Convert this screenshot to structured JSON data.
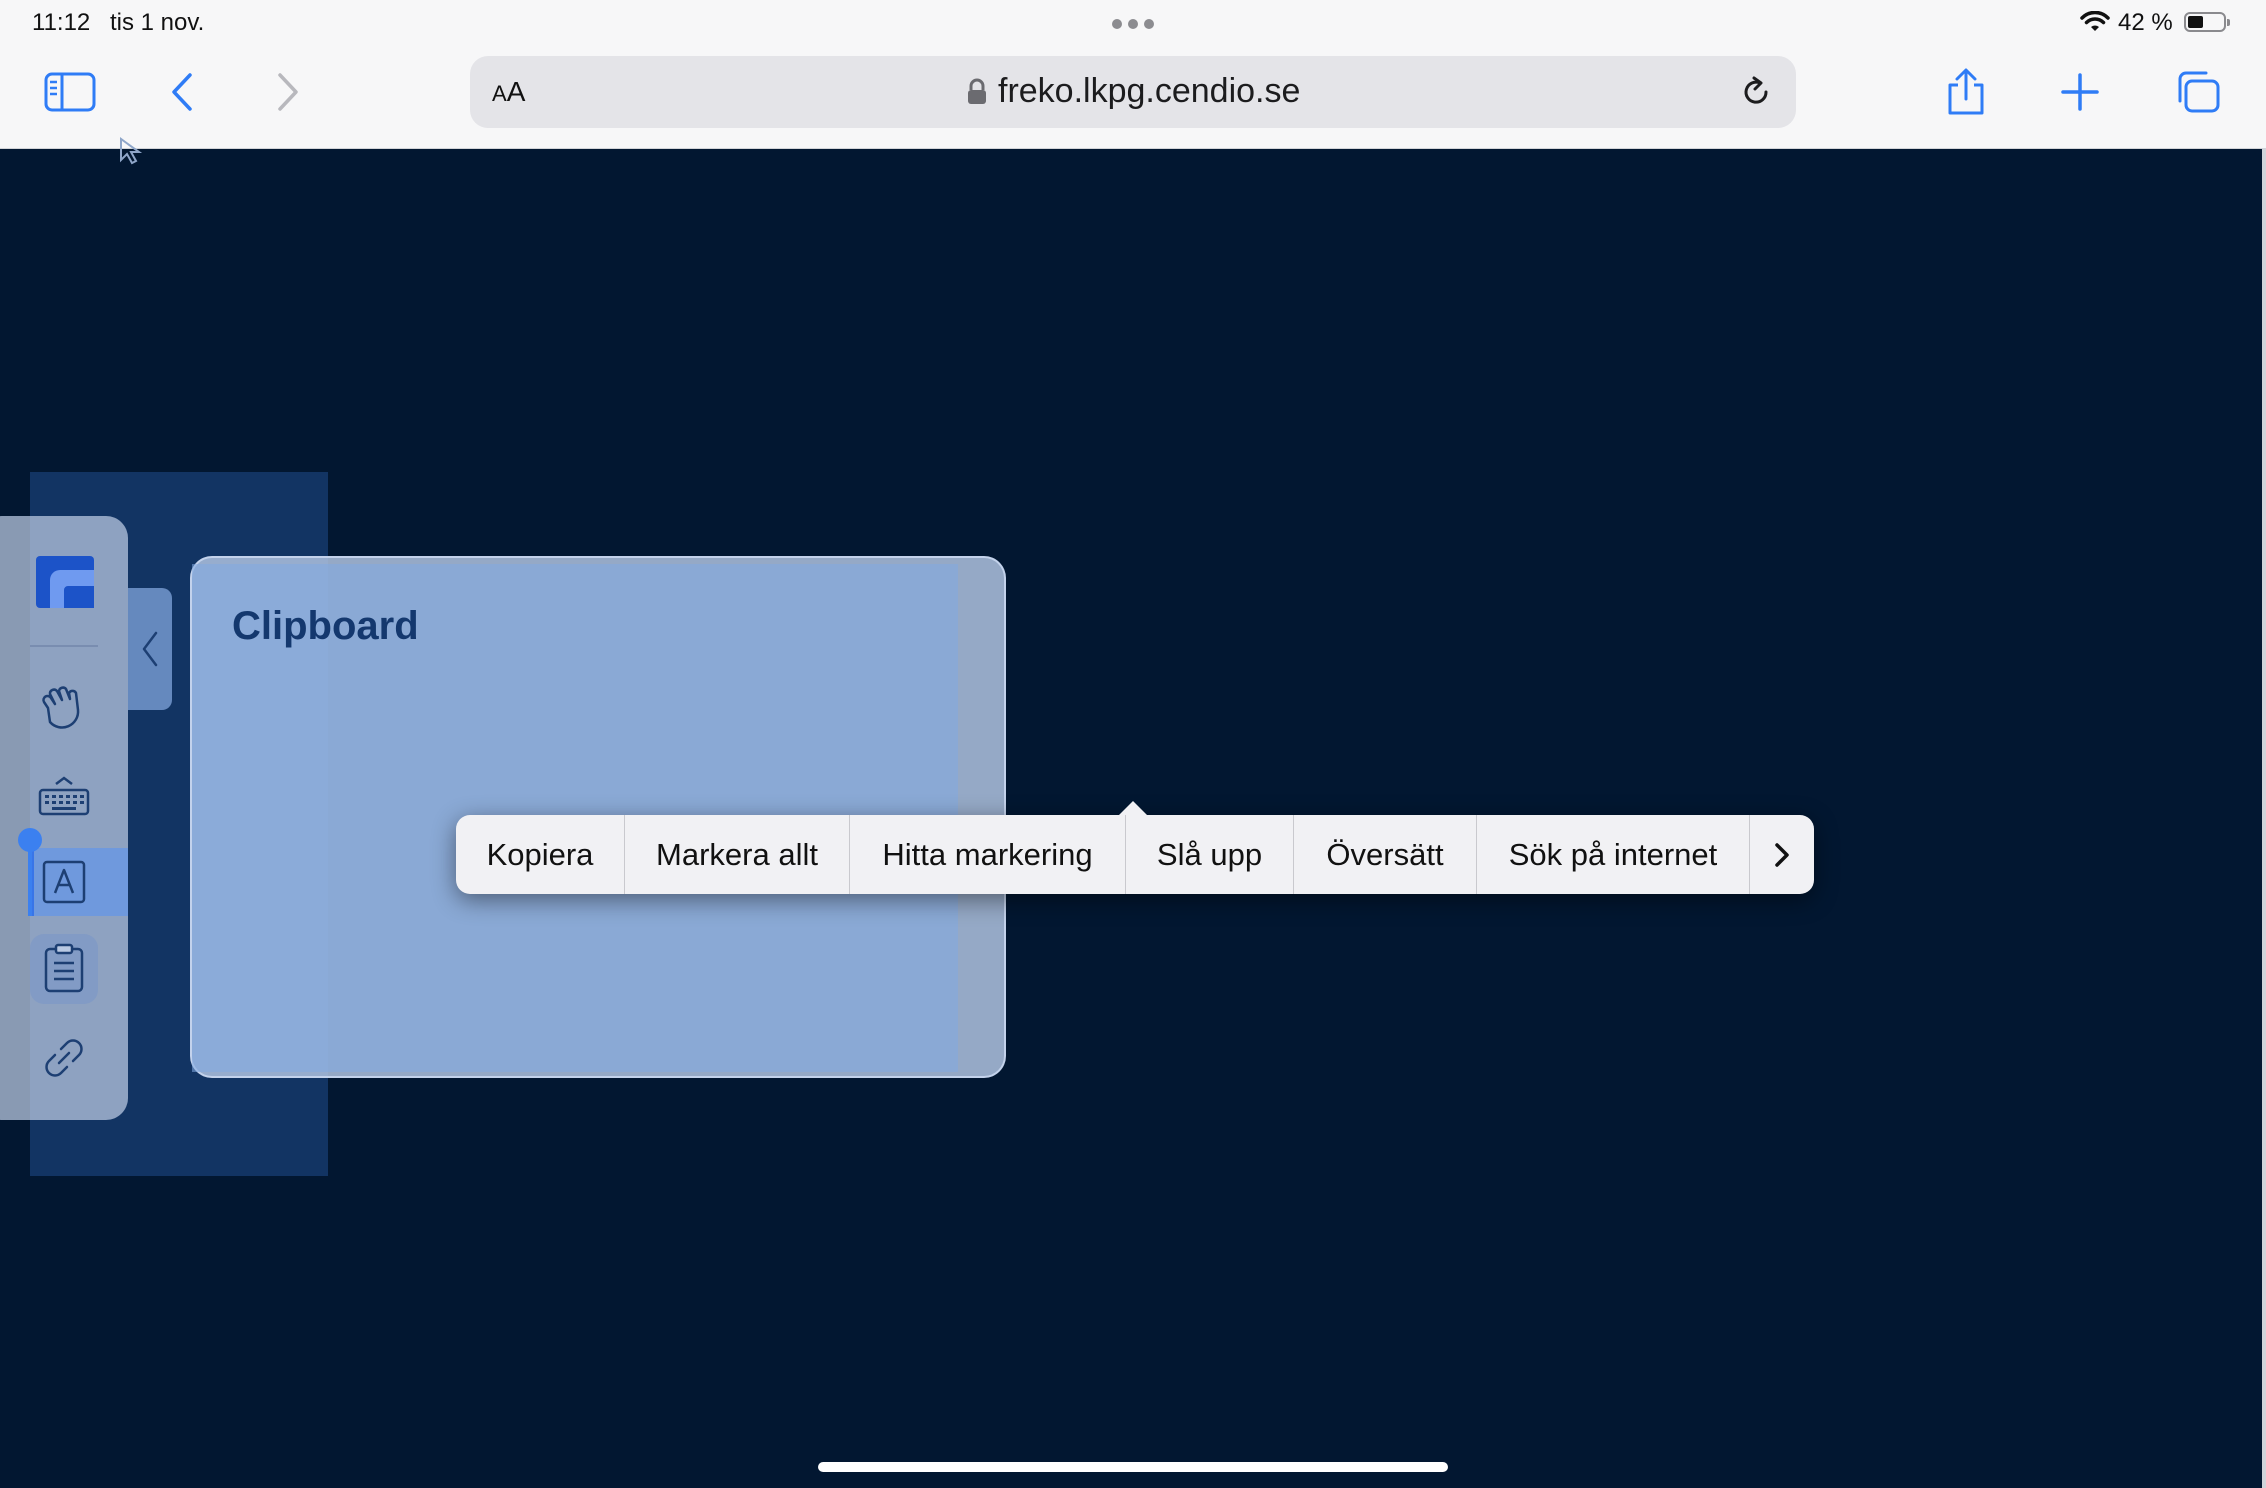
{
  "status_bar": {
    "time": "11:12",
    "date": "tis 1 nov.",
    "battery_percent": "42 %",
    "battery_level": 0.42
  },
  "browser": {
    "reader_label_small": "A",
    "reader_label_large": "A",
    "url": "freko.lkpg.cendio.se",
    "accent_color": "#2f7cf6"
  },
  "remote_app": {
    "panel_title": "Clipboard",
    "tools": [
      {
        "icon": "hand-icon"
      },
      {
        "icon": "keyboard-icon"
      },
      {
        "icon": "text-input-icon"
      },
      {
        "icon": "clipboard-icon"
      },
      {
        "icon": "disconnect-icon"
      }
    ],
    "colors": {
      "background": "#021731",
      "panel": "#afc3e1",
      "title": "#14386e"
    }
  },
  "edit_menu": {
    "items": [
      {
        "label": "Kopiera"
      },
      {
        "label": "Markera allt"
      },
      {
        "label": "Hitta markering"
      },
      {
        "label": "Slå upp"
      },
      {
        "label": "Översätt"
      },
      {
        "label": "Sök på internet"
      }
    ]
  }
}
